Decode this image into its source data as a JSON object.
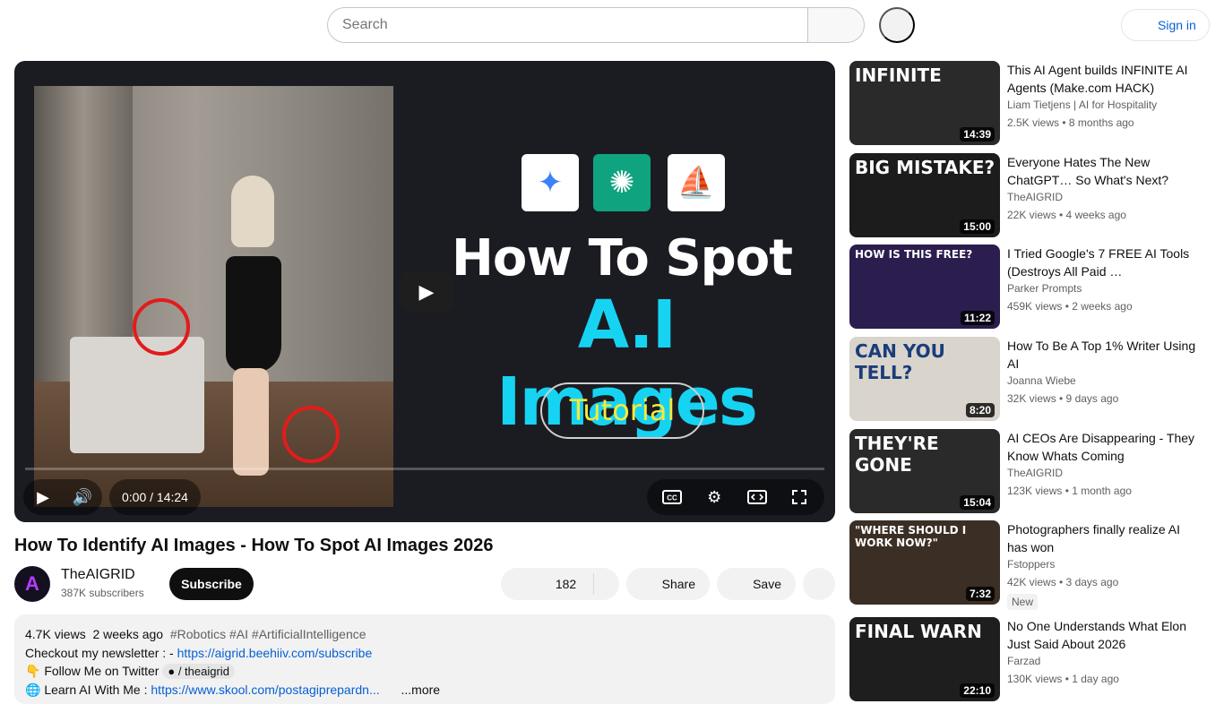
{
  "search": {
    "placeholder": "Search"
  },
  "header": {
    "signin_label": "Sign in"
  },
  "player": {
    "thumbnail_title_line1": "How To Spot",
    "thumbnail_title_line2": "A.I Images",
    "thumbnail_pill": "Tutorial",
    "time": "0:00 / 14:24",
    "progress": 0
  },
  "video": {
    "title": "How To Identify AI Images - How To Spot AI Images 2026",
    "channel": "TheAIGRID",
    "subscribers": "387K subscribers",
    "subscribe_label": "Subscribe",
    "likes": "182",
    "share_label": "Share",
    "save_label": "Save"
  },
  "description": {
    "views": "4.7K views",
    "date": "2 weeks ago",
    "hashtags": "#Robotics #AI #ArtificialIntelligence",
    "newsletter_text": "Checkout my newsletter : -",
    "newsletter_link": "https://aigrid.beehiiv.com/subscribe",
    "twitter_text": "Follow Me on Twitter",
    "twitter_handle": "/ theaigrid",
    "learn_text": "Learn AI With Me :",
    "learn_link": "https://www.skool.com/postagiprepardn...",
    "more_label": "...more"
  },
  "recommendations": [
    {
      "title": "This AI Agent builds INFINITE AI Agents (Make.com HACK)",
      "channel": "Liam Tietjens | AI for Hospitality",
      "meta": "2.5K views • 8 months ago",
      "duration": "14:39",
      "thumb_text": "INFINITE",
      "thumb_color": "#2a2a2a"
    },
    {
      "title": "Everyone Hates The New ChatGPT… So What's Next?",
      "channel": "TheAIGRID",
      "meta": "22K views • 4 weeks ago",
      "duration": "15:00",
      "thumb_text": "BIG MISTAKE?",
      "thumb_color": "#1c1c1c"
    },
    {
      "title": "I Tried Google's 7 FREE AI Tools (Destroys All Paid …",
      "channel": "Parker Prompts",
      "meta": "459K views • 2 weeks ago",
      "duration": "11:22",
      "thumb_text": "HOW IS THIS FREE?",
      "thumb_color": "#2b1d4d"
    },
    {
      "title": "How To Be A Top 1% Writer Using AI",
      "channel": "Joanna Wiebe",
      "meta": "32K views • 9 days ago",
      "duration": "8:20",
      "thumb_text": "CAN YOU TELL?",
      "thumb_color": "#d9d4cc"
    },
    {
      "title": "AI CEOs Are Disappearing - They Know Whats Coming",
      "channel": "TheAIGRID",
      "meta": "123K views • 1 month ago",
      "duration": "15:04",
      "thumb_text": "THEY'RE GONE",
      "thumb_color": "#2a2a2a"
    },
    {
      "title": "Photographers finally realize AI has won",
      "channel": "Fstoppers",
      "meta": "42K views • 3 days ago",
      "duration": "7:32",
      "thumb_text": "\"WHERE SHOULD I WORK NOW?\"",
      "thumb_color": "#3b2f25",
      "badge": "New"
    },
    {
      "title": "No One Understands What Elon Just Said About 2026",
      "channel": "Farzad",
      "meta": "130K views • 1 day ago",
      "duration": "22:10",
      "thumb_text": "FINAL WARN",
      "thumb_color": "#1e1e1e"
    }
  ]
}
